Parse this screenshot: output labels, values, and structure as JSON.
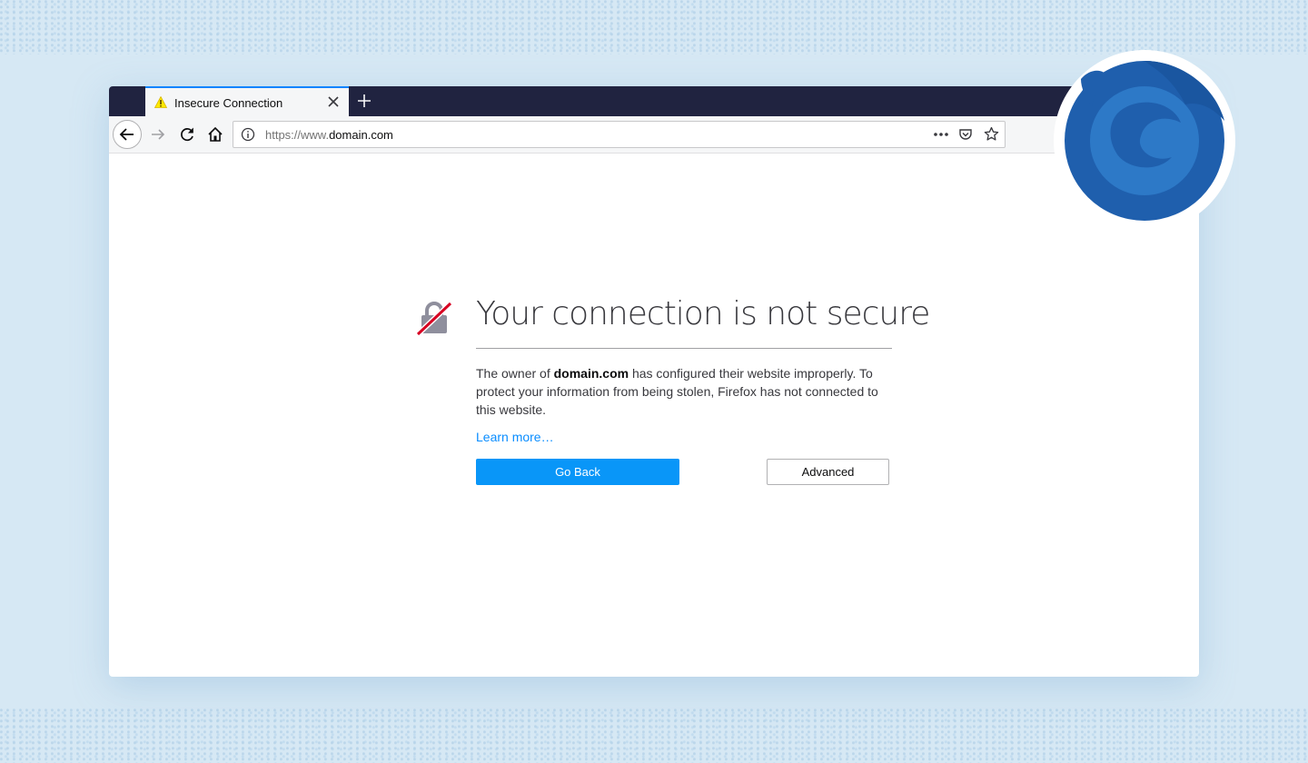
{
  "tab": {
    "title": "Insecure Connection"
  },
  "urlbar": {
    "prefix": "https://www.",
    "domain": "domain.com"
  },
  "error": {
    "title": "Your connection is not secure",
    "desc_before": "The owner of ",
    "desc_domain": "domain.com",
    "desc_after": " has configured their website improperly. To protect your information from being stolen, Firefox has not connected to this website.",
    "learn_more": "Learn more…",
    "go_back_label": "Go Back",
    "advanced_label": "Advanced"
  },
  "colors": {
    "tabbar_bg": "#202340",
    "accent_blue": "#0996f8",
    "link_blue": "#0a8dff",
    "background": "#d6e8f4"
  },
  "icons": [
    "warning-icon",
    "close-icon",
    "plus-icon",
    "back-arrow-icon",
    "forward-arrow-icon",
    "reload-icon",
    "home-icon",
    "info-icon",
    "more-icon",
    "pocket-icon",
    "star-icon",
    "broken-lock-icon",
    "firefox-logo"
  ]
}
